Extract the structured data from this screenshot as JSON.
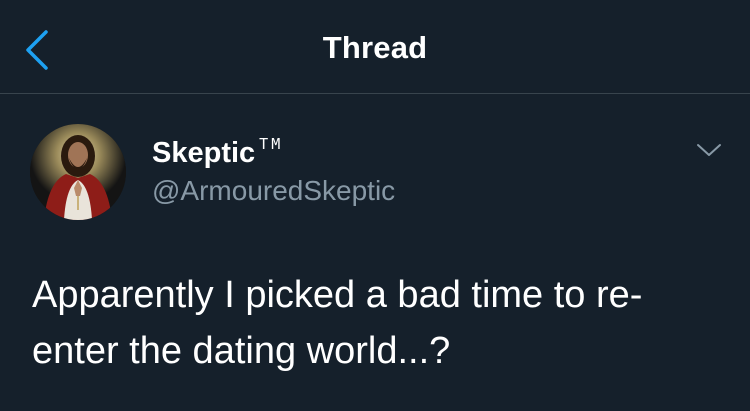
{
  "header": {
    "title": "Thread",
    "back_icon": "chevron-left-icon",
    "accent_color": "#1da1f2"
  },
  "tweet": {
    "display_name": "Skeptic",
    "name_suffix": "TM",
    "handle": "@ArmouredSkeptic",
    "avatar": "jesus-portrait-avatar",
    "menu_icon": "chevron-down-icon",
    "text": "Apparently I picked a bad time to re-enter the dating world...?"
  },
  "colors": {
    "background": "#15202b",
    "divider": "#38444d",
    "secondary_text": "#8899a6",
    "primary_text": "#ffffff"
  }
}
